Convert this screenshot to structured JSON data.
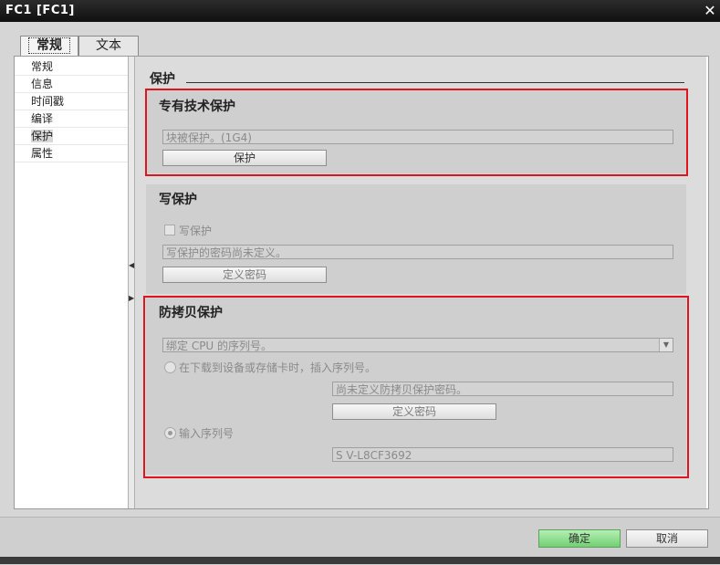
{
  "window": {
    "title": "FC1 [FC1]"
  },
  "tabs": [
    {
      "label": "常规"
    },
    {
      "label": "文本"
    }
  ],
  "nav": {
    "items": [
      {
        "label": "常规"
      },
      {
        "label": "信息"
      },
      {
        "label": "时间戳"
      },
      {
        "label": "编译"
      },
      {
        "label": "保护"
      },
      {
        "label": "属性"
      }
    ],
    "selected": "保护"
  },
  "protection": {
    "section_title": "保护",
    "know_how": {
      "title": "专有技术保护",
      "status": "块被保护。(1G4)",
      "button": "保护"
    },
    "write": {
      "title": "写保护",
      "checkbox_label": "写保护",
      "status": "写保护的密码尚未定义。",
      "button": "定义密码"
    },
    "copy": {
      "title": "防拷贝保护",
      "combo_value": "绑定 CPU 的序列号。",
      "option1_label": "在下载到设备或存储卡时，插入序列号。",
      "password_status": "尚未定义防拷贝保护密码。",
      "button": "定义密码",
      "option2_label": "输入序列号",
      "serial_value": "S V-L8CF3692"
    }
  },
  "footer": {
    "ok": "确定",
    "cancel": "取消"
  },
  "colors": {
    "highlight": "#e0141c",
    "ok_button": "#84d884"
  }
}
